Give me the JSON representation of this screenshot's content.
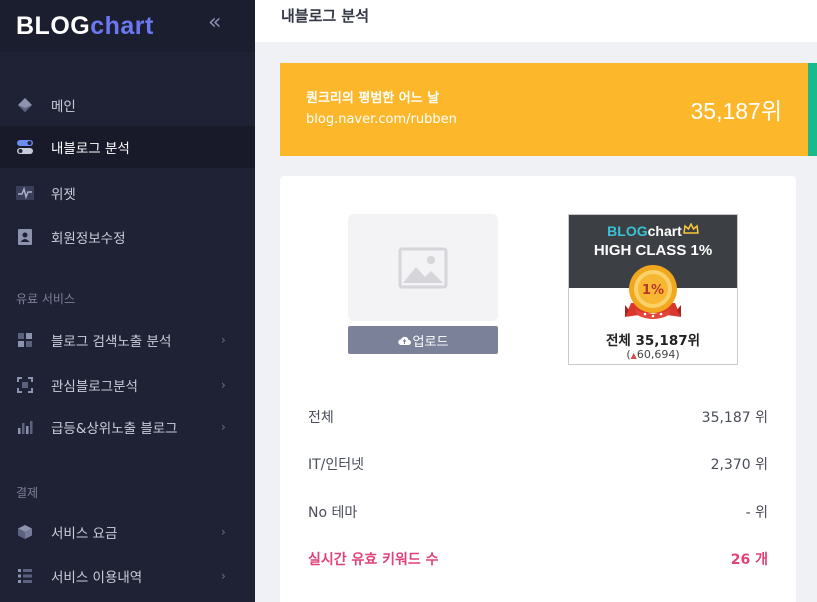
{
  "sidebar": {
    "logo_main": "BLOG",
    "logo_accent": "chart",
    "collapse_glyph": "«",
    "items": [
      {
        "label": "메인",
        "icon": "diamond-icon"
      },
      {
        "label": "내블로그 분석",
        "icon": "toggle-icon"
      },
      {
        "label": "위젯",
        "icon": "pulse-icon"
      },
      {
        "label": "회원정보수정",
        "icon": "user-card-icon"
      }
    ],
    "section_paid": "유료 서비스",
    "paid_items": [
      {
        "label": "블로그 검색노출 분석",
        "icon": "grid-icon"
      },
      {
        "label": "관심블로그분석",
        "icon": "focus-icon"
      },
      {
        "label": "급등&상위노출 블로그",
        "icon": "bar-chart-icon"
      }
    ],
    "section_payment": "결제",
    "payment_items": [
      {
        "label": "서비스 요금",
        "icon": "cube-icon"
      },
      {
        "label": "서비스 이용내역",
        "icon": "list-icon"
      }
    ],
    "chevron": "›"
  },
  "header": {
    "title": "내블로그 분석"
  },
  "banner": {
    "blog_name": "퀀크리의 평범한 어느 날",
    "blog_url": "blog.naver.com/rubben",
    "rank": "35,187위",
    "colors": {
      "bg": "#fcb72a",
      "side": "#1bb98c"
    }
  },
  "profile": {
    "upload_label": "업로드",
    "upload_icon": "cloud-upload-icon",
    "placeholder_icon": "image-icon"
  },
  "badge": {
    "logo_main": "BLOG",
    "logo_accent": "chart",
    "class_label": "HIGH CLASS 1%",
    "medal_text": "1%",
    "rank_text": "전체 35,187위",
    "change_open": "(",
    "change_value": "60,694",
    "change_close": ")"
  },
  "stats": [
    {
      "label": "전체",
      "value": "35,187 위"
    },
    {
      "label": "IT/인터넷",
      "value": "2,370 위"
    },
    {
      "label": "No 테마",
      "value": "- 위"
    },
    {
      "label": "실시간 유효 키워드 수",
      "value": "26 개"
    }
  ]
}
